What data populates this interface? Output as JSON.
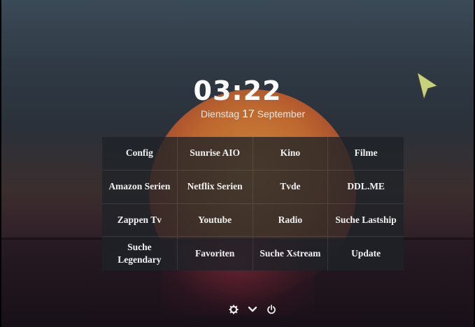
{
  "clock": {
    "time": "03:22"
  },
  "date": {
    "weekday": "Dienstag",
    "day": "17",
    "month": "September"
  },
  "menu": {
    "tiles": [
      [
        "Config",
        "Sunrise AIO",
        "Kino",
        "Filme"
      ],
      [
        "Amazon Serien",
        "Netflix Serien",
        "Tvde",
        "DDL.ME"
      ],
      [
        "Zappen Tv",
        "Youtube",
        "Radio",
        "Suche Lastship"
      ],
      [
        "Suche\nLegendary",
        "Favoriten",
        "Suche Xstream",
        "Update"
      ]
    ]
  },
  "bottom_bar": {
    "icons": [
      "gear-icon",
      "chevron-down-icon",
      "power-icon"
    ]
  },
  "colors": {
    "accent_pointer": "#c8d27a"
  }
}
